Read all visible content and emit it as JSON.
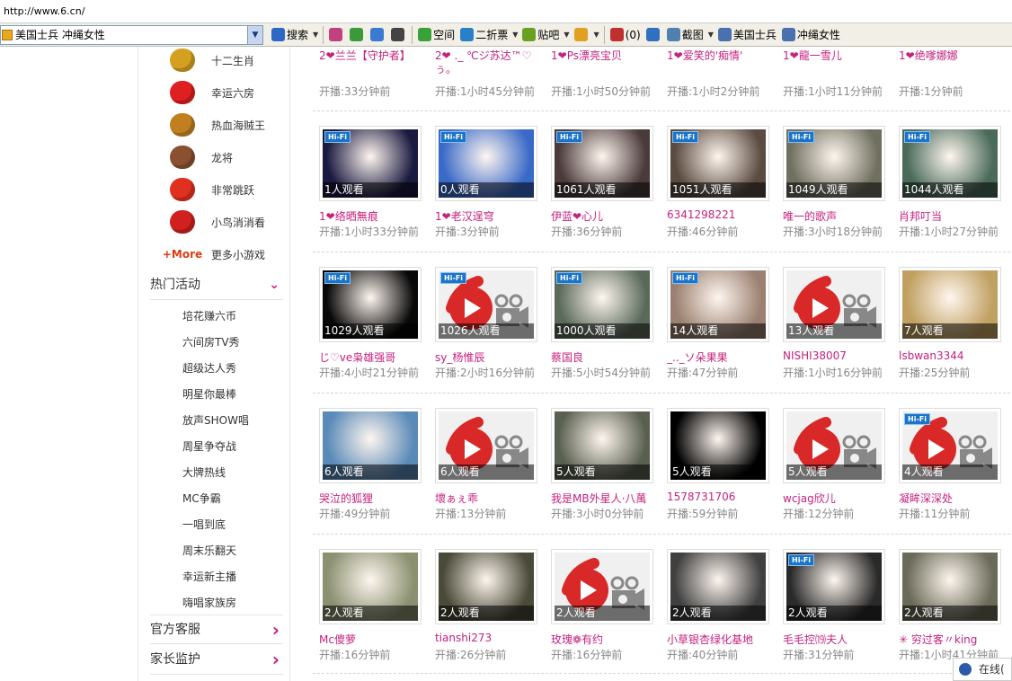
{
  "address": "http://www.6.cn/",
  "toolbar": {
    "search_text": "美国士兵 冲绳女性",
    "buttons": [
      {
        "label": "搜索",
        "icon": "search-icon",
        "color": "#2d68c4"
      },
      {
        "label": "",
        "icon": "refresh-icon",
        "color": "#c04080"
      },
      {
        "label": "",
        "icon": "save-icon",
        "color": "#3a9a3a"
      },
      {
        "label": "",
        "icon": "translate-icon",
        "color": "#3a7ad0"
      },
      {
        "label": "",
        "icon": "video-icon",
        "color": "#444444"
      },
      {
        "label": "空间",
        "icon": "space-icon",
        "color": "#3aa03a"
      },
      {
        "label": "二折票",
        "icon": "flight-icon",
        "color": "#2a80c8"
      },
      {
        "label": "贴吧",
        "icon": "tieba-icon",
        "color": "#6aa020"
      },
      {
        "label": "",
        "icon": "color-icon",
        "color": "#e0a020"
      },
      {
        "label": "(0)",
        "icon": "mail-icon",
        "color": "#c03030"
      },
      {
        "label": "",
        "icon": "pen-icon",
        "color": "#3070c0"
      },
      {
        "label": "截图",
        "icon": "screenshot-icon",
        "color": "#5080b0"
      },
      {
        "label": "美国士兵",
        "icon": "page-search-icon",
        "color": "#4a70b0"
      },
      {
        "label": "冲绳女性",
        "icon": "page-search-icon",
        "color": "#4a70b0"
      }
    ]
  },
  "sidebar": {
    "games": [
      {
        "label": "十二生肖",
        "icon": "zodiac-icon",
        "color": "#d4a020"
      },
      {
        "label": "幸运六房",
        "icon": "lucky-six-icon",
        "color": "#e02020"
      },
      {
        "label": "热血海贼王",
        "icon": "pirate-icon",
        "color": "#c08020"
      },
      {
        "label": "龙将",
        "icon": "dragon-general-icon",
        "color": "#8a5030"
      },
      {
        "label": "非常跳跃",
        "icon": "jump-icon",
        "color": "#e03020"
      },
      {
        "label": "小鸟消消看",
        "icon": "bird-icon",
        "color": "#d02020"
      },
      {
        "label": "更多小游戏",
        "icon": "more-games-icon",
        "color": "#e03a10",
        "badge": "+More"
      }
    ],
    "hot_title": "热门活动",
    "activities": [
      "培花赚六币",
      "六间房TV秀",
      "超级达人秀",
      "明星你最棒",
      "放声SHOW唱",
      "周星争夺战",
      "大牌热线",
      "MC争霸",
      "一唱到底",
      "周末乐翻天",
      "幸运新主播",
      "嗨唱家族房"
    ],
    "service": "官方客服",
    "parent": "家长监护"
  },
  "top_row": [
    {
      "name": "2❤兰兰【守护者】",
      "time": "开播:33分钟前"
    },
    {
      "name": "2❤ ._ ℃ジ苏达™♡ぅ。",
      "time": "开播:1小时45分钟前"
    },
    {
      "name": "1❤Ps漂亮宝贝",
      "time": "开播:1小时50分钟前"
    },
    {
      "name": "1❤爱笑的'痴情'",
      "time": "开播:1小时2分钟前"
    },
    {
      "name": "1❤龍一雪儿",
      "time": "开播:1小时11分钟前"
    },
    {
      "name": "1❤绝嗲娜娜",
      "time": "开播:1分钟前"
    }
  ],
  "rows": [
    [
      {
        "name": "1❤络晒無痕",
        "time": "开播:1小时33分钟前",
        "count": "1人观看",
        "hifi": true,
        "thumb": "#1a1a40"
      },
      {
        "name": "1❤老汉逞穹",
        "time": "开播:3分钟前",
        "count": "0人观看",
        "hifi": true,
        "thumb": "#3a6ac8"
      },
      {
        "name": "伊蓝❤心儿",
        "time": "开播:36分钟前",
        "count": "1061人观看",
        "hifi": true,
        "thumb": "#4a3a3a"
      },
      {
        "name": "6341298221",
        "time": "开播:46分钟前",
        "count": "1051人观看",
        "hifi": true,
        "thumb": "#5a4a40"
      },
      {
        "name": "唯一的歌声",
        "time": "开播:3小时18分钟前",
        "count": "1049人观看",
        "hifi": true,
        "thumb": "#707060"
      },
      {
        "name": "肖邦叮当",
        "time": "开播:1小时27分钟前",
        "count": "1044人观看",
        "hifi": true,
        "thumb": "#4a6a5a"
      }
    ],
    [
      {
        "name": "じ♡ve枭雄强哥",
        "time": "开播:4小时21分钟前",
        "count": "1029人观看",
        "hifi": true,
        "thumb": "#080808"
      },
      {
        "name": "sy_杨惟辰",
        "time": "开播:2小时16分钟前",
        "count": "1026人观看",
        "hifi": true,
        "thumb": "logo"
      },
      {
        "name": "蔡国良",
        "time": "开播:5小时54分钟前",
        "count": "1000人观看",
        "hifi": true,
        "thumb": "#5a6a5a"
      },
      {
        "name": "_.._ソ朵果果",
        "time": "开播:47分钟前",
        "count": "14人观看",
        "hifi": true,
        "thumb": "#9a8070"
      },
      {
        "name": "NISHI38007",
        "time": "开播:1小时16分钟前",
        "count": "13人观看",
        "hifi": false,
        "thumb": "logo"
      },
      {
        "name": "lsbwan3344",
        "time": "开播:25分钟前",
        "count": "7人观看",
        "hifi": false,
        "thumb": "#c0a060"
      }
    ],
    [
      {
        "name": "哭泣的狐狸",
        "time": "开播:49分钟前",
        "count": "6人观看",
        "hifi": false,
        "thumb": "#5a8ab8"
      },
      {
        "name": "壞ぁぇ乖",
        "time": "开播:13分钟前",
        "count": "6人观看",
        "hifi": false,
        "thumb": "logo"
      },
      {
        "name": "我是MB外星人·八萬",
        "time": "开播:3小时0分钟前",
        "count": "5人观看",
        "hifi": false,
        "thumb": "#5a6050"
      },
      {
        "name": "1578731706",
        "time": "开播:59分钟前",
        "count": "5人观看",
        "hifi": false,
        "thumb": "#000000"
      },
      {
        "name": "wcjag欣儿",
        "time": "开播:12分钟前",
        "count": "5人观看",
        "hifi": false,
        "thumb": "logo"
      },
      {
        "name": "凝眸深深处",
        "time": "开播:11分钟前",
        "count": "4人观看",
        "hifi": true,
        "thumb": "logo"
      }
    ],
    [
      {
        "name": "Mc傻萝",
        "time": "开播:16分钟前",
        "count": "2人观看",
        "hifi": false,
        "thumb": "#8a9070"
      },
      {
        "name": "tianshi273",
        "time": "开播:26分钟前",
        "count": "2人观看",
        "hifi": false,
        "thumb": "#4a4a38"
      },
      {
        "name": "玫瑰❁有约",
        "time": "开播:16分钟前",
        "count": "2人观看",
        "hifi": false,
        "thumb": "logo"
      },
      {
        "name": "小草银杏绿化基地",
        "time": "开播:40分钟前",
        "count": "2人观看",
        "hifi": false,
        "thumb": "#404040"
      },
      {
        "name": "毛毛控⒆夫人",
        "time": "开播:31分钟前",
        "count": "2人观看",
        "hifi": true,
        "thumb": "#2a2a2a"
      },
      {
        "name": "✳ 穷过客〃king",
        "time": "开播:1小时41分钟前",
        "count": "2人观看",
        "hifi": false,
        "thumb": "#6a6a58"
      }
    ]
  ],
  "status": {
    "online": "在线(",
    "hifi_label": "Hi-Fi"
  }
}
